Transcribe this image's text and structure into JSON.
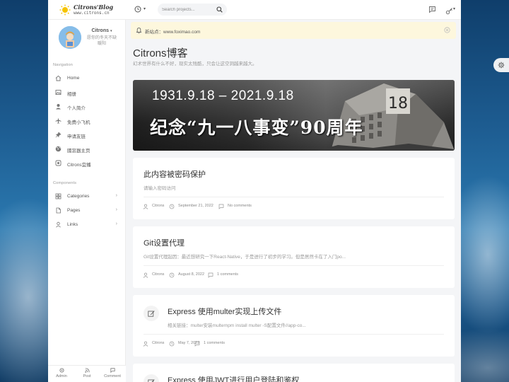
{
  "header": {
    "logo_title": "Citrons'Blog",
    "logo_subtitle": "www.citrons.cn",
    "search_placeholder": "Search projects..."
  },
  "profile": {
    "name": "Citrons",
    "bio_line1": "愿你的冬天不缺",
    "bio_line2": "暖阳"
  },
  "sidebar": {
    "navigation_heading": "Navigation",
    "nav_items": [
      {
        "label": "Home",
        "icon": "home-icon"
      },
      {
        "label": "相册",
        "icon": "image-icon"
      },
      {
        "label": "个人简介",
        "icon": "user-icon"
      },
      {
        "label": "免费小飞机",
        "icon": "plane-icon"
      },
      {
        "label": "申请友链",
        "icon": "pin-icon"
      },
      {
        "label": "國窓器主页",
        "icon": "globe-icon"
      },
      {
        "label": "Citrons宜播",
        "icon": "app-icon"
      }
    ],
    "components_heading": "Components",
    "component_items": [
      {
        "label": "Categories",
        "icon": "grid-icon"
      },
      {
        "label": "Pages",
        "icon": "file-icon"
      },
      {
        "label": "Links",
        "icon": "person-icon"
      }
    ],
    "footer": {
      "admin": "Admin",
      "post": "Post",
      "comment": "Comment"
    }
  },
  "notice": {
    "text": "新站点：www.foximao.com"
  },
  "blog": {
    "title": "Citrons博客",
    "subtitle": "幻术世界有什么不好，现实太残酷，只会让这空洞越来越大。"
  },
  "banner": {
    "date_text": "1931.9.18 – 2021.9.18",
    "headline": "纪念“九一八事变”90周年",
    "monument_number": "18"
  },
  "posts": [
    {
      "title": "此内容被密码保护",
      "excerpt": "请输入密码访问",
      "author": "Citrons",
      "date": "September 21, 2022",
      "comments": "No comments"
    },
    {
      "title": "Git设置代理",
      "excerpt": "Git设置代理起因：最近想研究一下React-Native，于是进行了初步的学习。但是居然卡在了入门po...",
      "author": "Citrons",
      "date": "August 8, 2022",
      "comments": "1 comments"
    },
    {
      "title": "Express 使用multer实现上传文件",
      "excerpt": "相关链接：multer安装multernpm install multer -S配置文件//app-co...",
      "author": "Citrons",
      "date": "May 7, 2022",
      "comments": "1 comments"
    },
    {
      "title": "Express 使用JWT进行用户登陆和鉴权"
    }
  ],
  "colors": {
    "notice_bg": "#fdf7dd",
    "page_bg": "#f4f5f7",
    "card_bg": "#ffffff"
  }
}
